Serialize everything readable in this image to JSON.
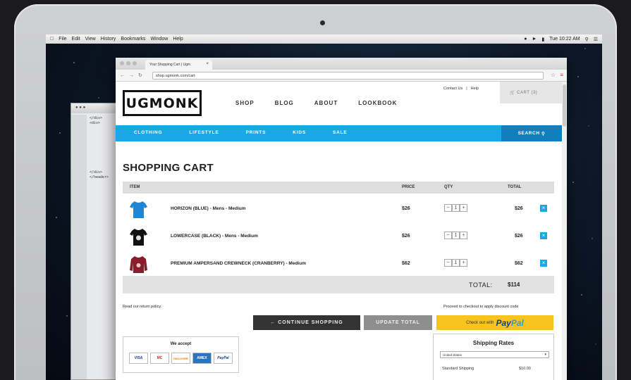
{
  "menubar": {
    "items": [
      "File",
      "Edit",
      "View",
      "History",
      "Bookmarks",
      "Window",
      "Help"
    ],
    "clock": "Tue 10:22 AM"
  },
  "browser": {
    "tab_title": "Your Shopping Cart | Ugm",
    "url": "shop.ugmonk.com/cart"
  },
  "site": {
    "logo": "UGMONK",
    "top_links": [
      "Contact Us",
      "|",
      "Help"
    ],
    "cart_label": "CART (3)",
    "nav": [
      "SHOP",
      "BLOG",
      "ABOUT",
      "LOOKBOOK"
    ],
    "categories": [
      "CLOTHING",
      "LIFESTYLE",
      "PRINTS",
      "KIDS",
      "SALE"
    ],
    "search_label": "SEARCH"
  },
  "cart": {
    "title": "SHOPPING CART",
    "headers": {
      "item": "ITEM",
      "price": "PRICE",
      "qty": "QTY",
      "total": "TOTAL"
    },
    "rows": [
      {
        "name": "HORIZON (BLUE) - Mens - Medium",
        "price": "$26",
        "qty": "1",
        "total": "$26",
        "color": "#1d86d4"
      },
      {
        "name": "LOWERCASE (BLACK) - Mens - Medium",
        "price": "$26",
        "qty": "1",
        "total": "$26",
        "color": "#111111"
      },
      {
        "name": "PREMIUM AMPERSAND CREWNECK (CRANBERRY) - Medium",
        "price": "$62",
        "qty": "1",
        "total": "$62",
        "color": "#8c1c2b"
      }
    ],
    "total_label": "TOTAL:",
    "total_value": "$114",
    "returns_text": "Read our return policy.",
    "checkout_note": "Proceed to checkout to apply discount code",
    "continue_label": "CONTINUE SHOPPING",
    "update_label": "UPDATE TOTAL",
    "paypal_prefix": "Check out with",
    "paypal_a": "Pay",
    "paypal_b": "Pal"
  },
  "payments": {
    "title": "We accept",
    "cards": [
      "VISA",
      "MC",
      "DISCOVER",
      "AMEX",
      "PayPal"
    ]
  },
  "shipping": {
    "title": "Shipping Rates",
    "country": "United States",
    "option": "Standard Shipping",
    "option_price": "$10.00"
  },
  "colors": {
    "accent": "#1ba6e8",
    "accent_dark": "#117fbf",
    "paypal": "#f7c41f"
  }
}
